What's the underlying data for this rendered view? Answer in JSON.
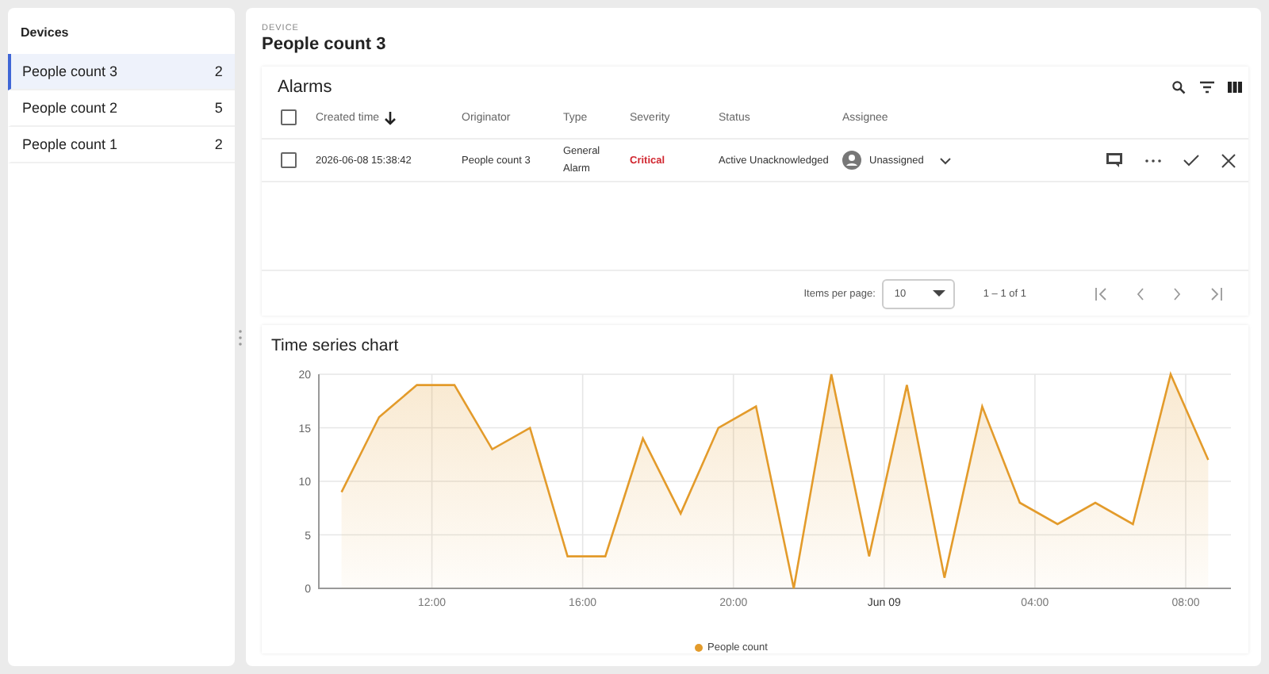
{
  "sidebar": {
    "title": "Devices",
    "items": [
      {
        "name": "People count 3",
        "count": "2",
        "selected": true
      },
      {
        "name": "People count 2",
        "count": "5",
        "selected": false
      },
      {
        "name": "People count 1",
        "count": "2",
        "selected": false
      }
    ]
  },
  "device": {
    "label": "DEVICE",
    "name": "People count 3"
  },
  "alarms": {
    "title": "Alarms",
    "select_all_checked": false,
    "columns": [
      {
        "label": "Created time",
        "sorted": true
      },
      {
        "label": "Originator",
        "sorted": false
      },
      {
        "label": "Type",
        "sorted": false
      },
      {
        "label": "Severity",
        "sorted": false
      },
      {
        "label": "Status",
        "sorted": false
      },
      {
        "label": "Assignee",
        "sorted": false
      }
    ],
    "rows": [
      {
        "checked": false,
        "created": "2026-06-08 15:38:42",
        "originator": "People count 3",
        "type": "General Alarm",
        "severity": "Critical",
        "color": "#d12730",
        "status": "Active Unacknowledged",
        "assignee": "Unassigned"
      }
    ],
    "pagination": {
      "items_per_page_label": "Items per page:",
      "items_per_page": "10",
      "range": "1 – 1 of 1"
    }
  },
  "chart": {
    "title": "Time series chart",
    "chart_data": {
      "type": "area",
      "x": [
        "2026-06-08T09:36",
        "2026-06-08T10:36",
        "2026-06-08T11:36",
        "2026-06-08T12:36",
        "2026-06-08T13:36",
        "2026-06-08T14:36",
        "2026-06-08T15:36",
        "2026-06-08T16:36",
        "2026-06-08T17:36",
        "2026-06-08T18:36",
        "2026-06-08T19:36",
        "2026-06-08T20:36",
        "2026-06-08T21:36",
        "2026-06-08T22:36",
        "2026-06-08T23:36",
        "2026-06-09T00:36",
        "2026-06-09T01:36",
        "2026-06-09T02:36",
        "2026-06-09T03:36",
        "2026-06-09T04:36",
        "2026-06-09T05:36",
        "2026-06-09T06:36",
        "2026-06-09T07:36",
        "2026-06-09T08:36"
      ],
      "series": [
        {
          "name": "People count",
          "color": "#e39b2b",
          "values": [
            9,
            16,
            19,
            19,
            13,
            15,
            3,
            3,
            14,
            7,
            15,
            17,
            0,
            20,
            3,
            19,
            1,
            17,
            8,
            6,
            8,
            6,
            20,
            12
          ]
        }
      ],
      "xlim": [
        "2026-06-08T09:00",
        "2026-06-09T09:12"
      ],
      "ylim": [
        0,
        20
      ],
      "grid": true,
      "xticks": [
        {
          "value": "2026-06-08T12:00",
          "label": "12:00"
        },
        {
          "value": "2026-06-08T16:00",
          "label": "16:00"
        },
        {
          "value": "2026-06-08T20:00",
          "label": "20:00"
        },
        {
          "value": "2026-06-09T00:00",
          "label": "Jun 09"
        },
        {
          "value": "2026-06-09T04:00",
          "label": "04:00"
        },
        {
          "value": "2026-06-09T08:00",
          "label": "08:00"
        }
      ],
      "yticks": [
        0,
        5,
        10,
        15,
        20
      ]
    }
  }
}
